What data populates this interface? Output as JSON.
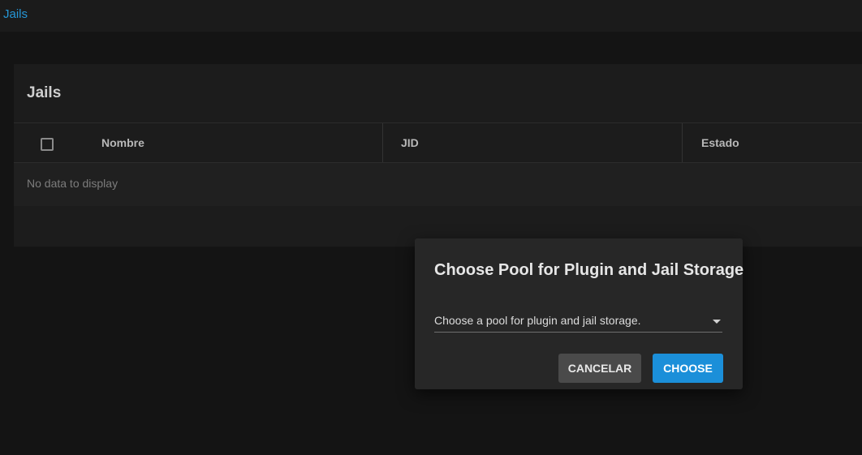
{
  "breadcrumb": {
    "link": "Jails"
  },
  "card": {
    "title": "Jails",
    "columns": [
      "Nombre",
      "JID",
      "Estado"
    ],
    "empty_message": "No data to display"
  },
  "dialog": {
    "title": "Choose Pool for Plugin and Jail Storage",
    "select_placeholder": "Choose a pool for plugin and jail storage.",
    "cancel_label": "CANCELAR",
    "choose_label": "CHOOSE"
  },
  "colors": {
    "accent": "#1b8fd9",
    "link": "#2596d6"
  }
}
